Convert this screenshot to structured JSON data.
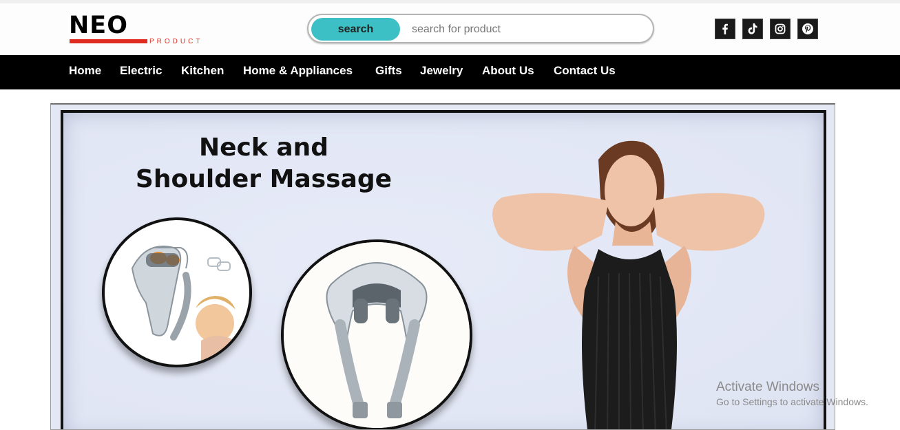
{
  "brand": {
    "name": "NEO",
    "tagline": "PRODUCT",
    "accent_color": "#e02b20"
  },
  "search": {
    "button_label": "search",
    "placeholder": "search for product",
    "button_color": "#3cc0c6"
  },
  "social": [
    {
      "icon": "facebook-icon"
    },
    {
      "icon": "tiktok-icon"
    },
    {
      "icon": "instagram-icon"
    },
    {
      "icon": "pinterest-icon"
    }
  ],
  "nav": {
    "items": [
      "Home",
      "Electric",
      "Kitchen",
      "Home & Appliances",
      "Gifts",
      "Jewelry",
      "About Us",
      "Contact Us"
    ],
    "background": "#000000"
  },
  "banner": {
    "headline_line1": "Neck and",
    "headline_line2": "Shoulder Massage",
    "background": "#e4e8f5"
  },
  "watermark": {
    "title": "Activate Windows",
    "subtitle": "Go to Settings to activate Windows."
  }
}
